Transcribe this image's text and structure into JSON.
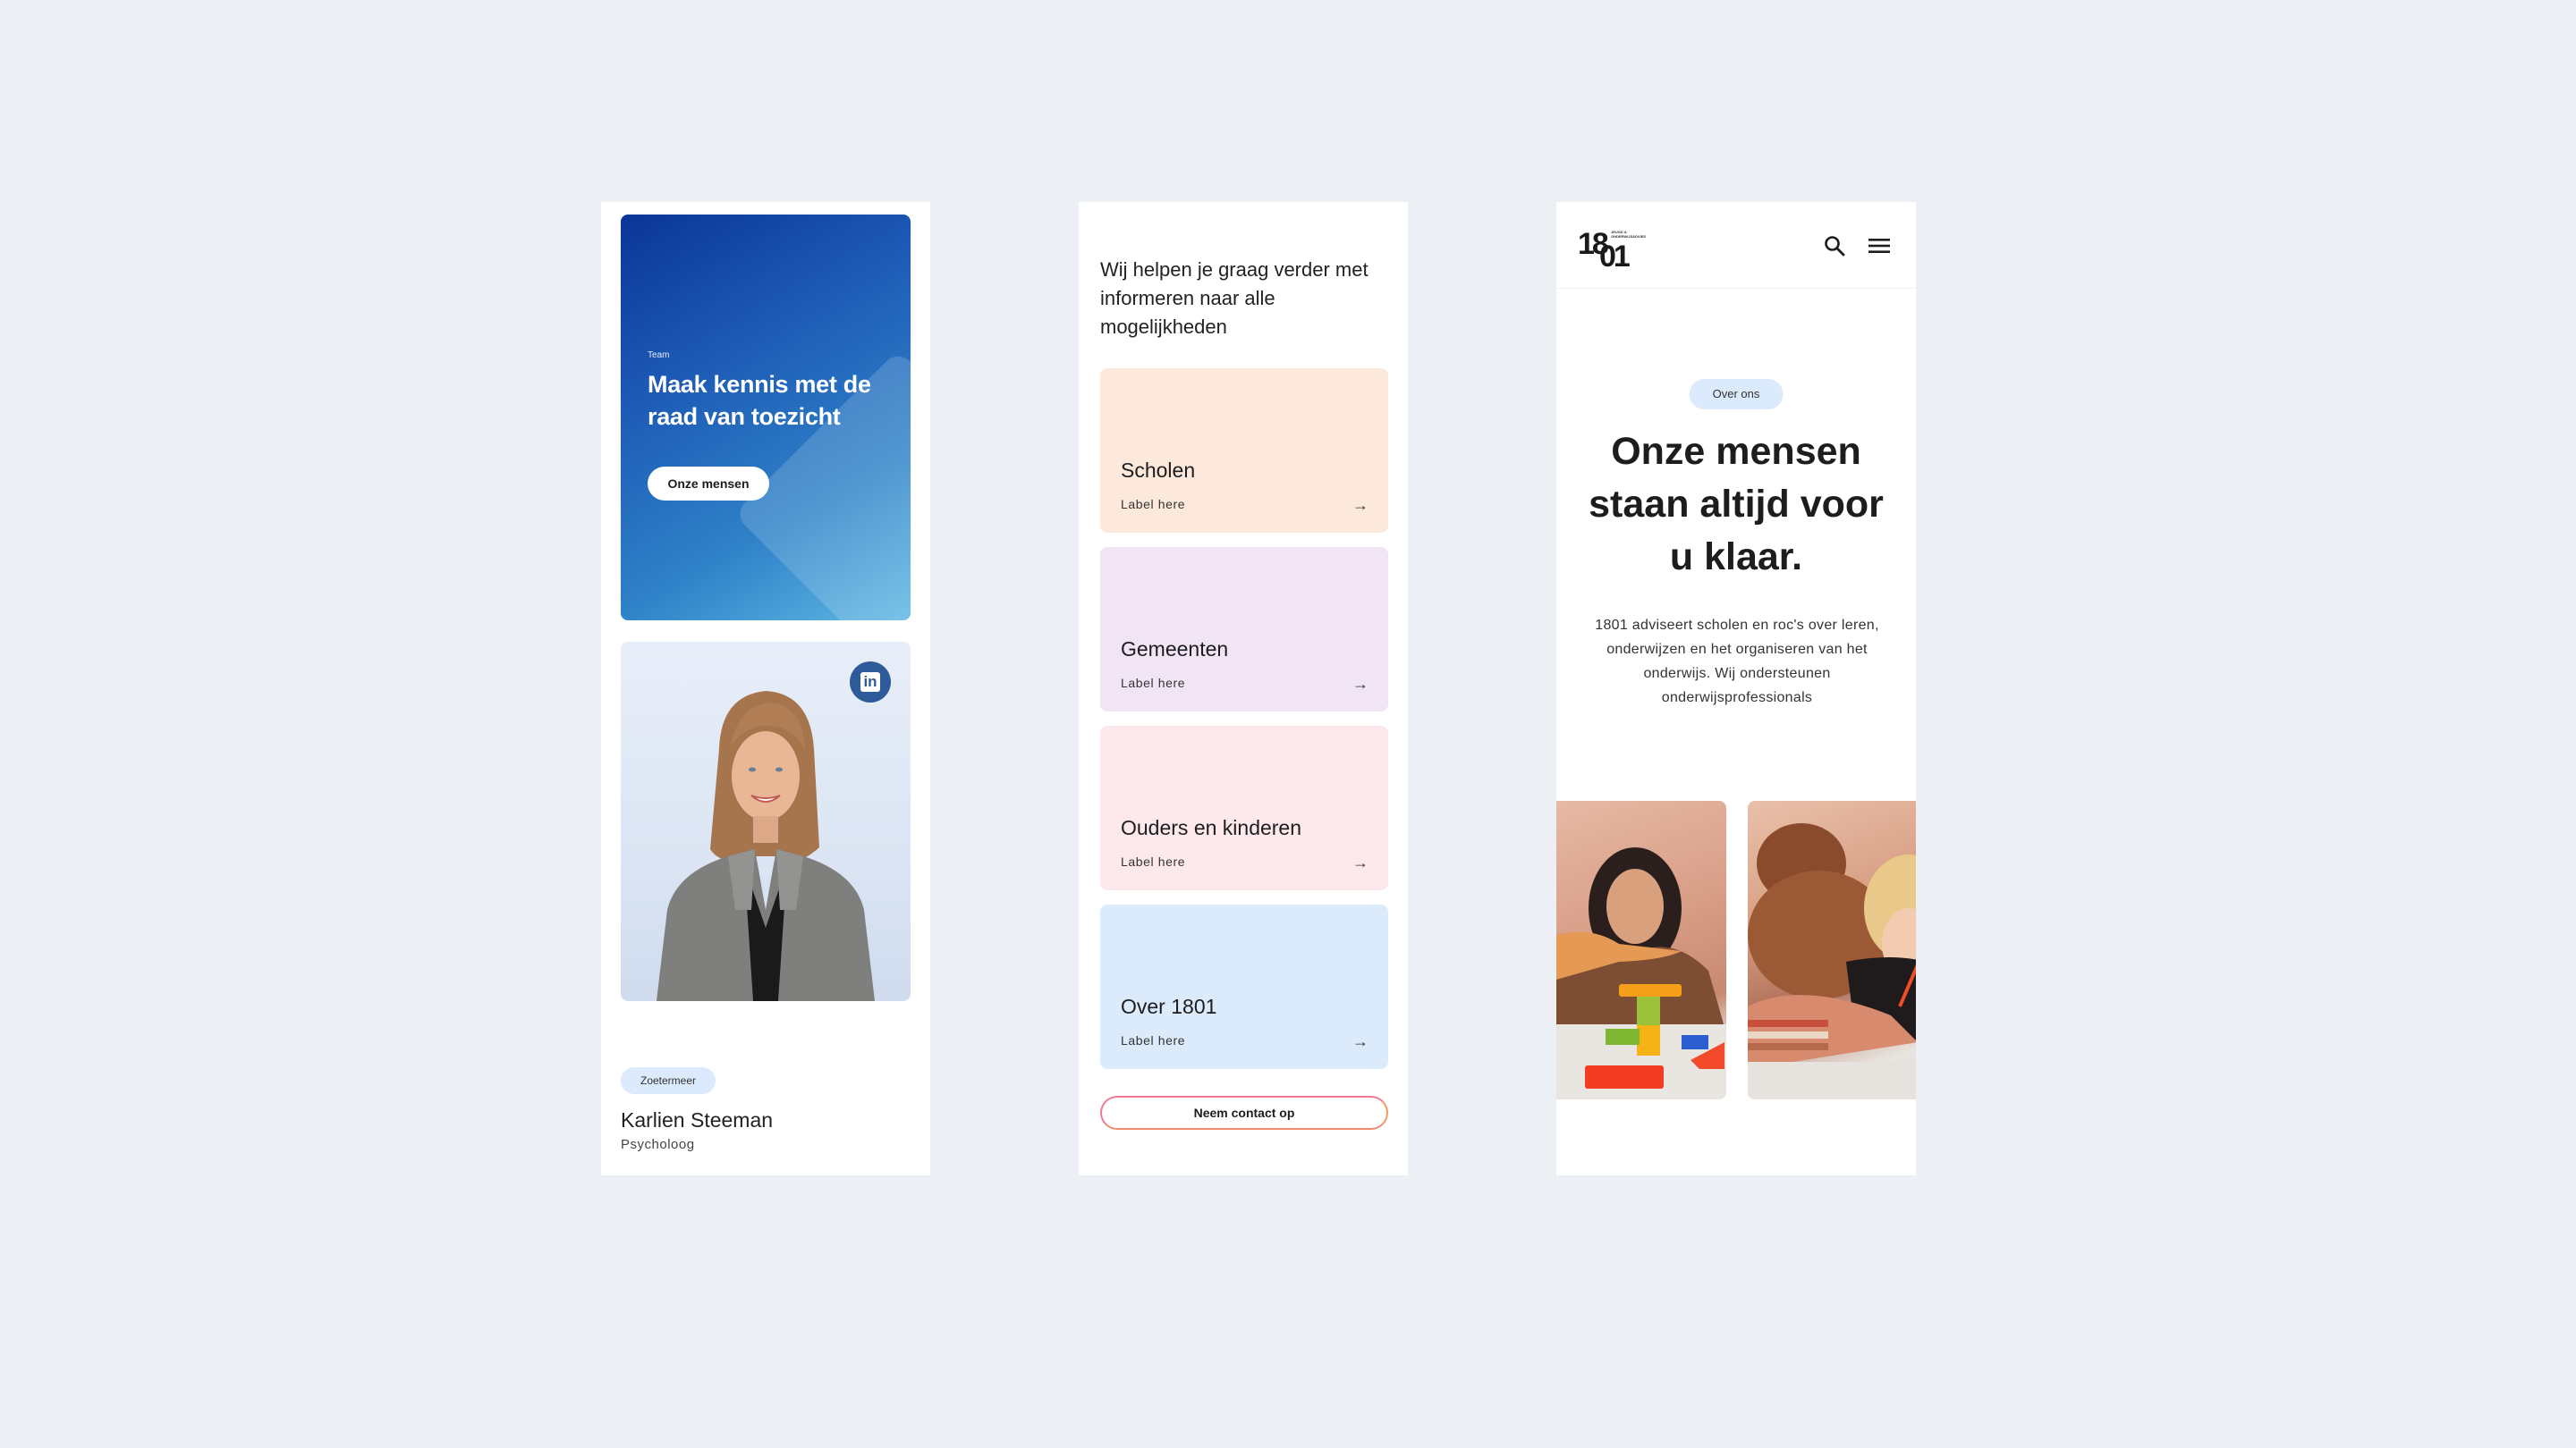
{
  "colors": {
    "page_background": "#ecf0f4",
    "team_card_gradient_start": "#0a3598",
    "team_card_gradient_end": "#5fb8e4",
    "linkedin_blue": "#2d5a98",
    "badge_blue": "#dbeafc",
    "tile_scholen": "#fde8dc",
    "tile_gemeenten": "#f0e4f5",
    "tile_ouders": "#fde9ec",
    "tile_over": "#dcebfb",
    "contact_border_start": "#f07a93",
    "contact_border_end": "#f29a5e"
  },
  "team_panel": {
    "card": {
      "eyebrow": "Team",
      "headline": "Maak kennis met de raad van toezicht",
      "button_label": "Onze mensen"
    },
    "profile": {
      "photo_alt": "Portrait of Karlien Steeman",
      "social_icon": "linkedin-icon",
      "social_label": "in",
      "location": "Zoetermeer",
      "name": "Karlien Steeman",
      "role": "Psycholoog"
    }
  },
  "help_panel": {
    "intro": "Wij helpen je graag verder met informeren naar alle mogelijkheden",
    "tiles": [
      {
        "title": "Scholen",
        "label": "Label here",
        "arrow": "→",
        "color": "#fde8dc"
      },
      {
        "title": "Gemeenten",
        "label": "Label here",
        "arrow": "→",
        "color": "#f0e4f5"
      },
      {
        "title": "Ouders en kinderen",
        "label": "Label here",
        "arrow": "→",
        "color": "#fde9ec"
      },
      {
        "title": "Over 1801",
        "label": "Label here",
        "arrow": "→",
        "color": "#dcebfb"
      }
    ],
    "contact_button": "Neem contact op"
  },
  "about_panel": {
    "header": {
      "logo_part_1": "18",
      "logo_part_2": "01",
      "logo_tagline": "JEUGD & ONDERWIJSADVIES",
      "search_icon": "search-icon",
      "menu_icon": "hamburger-menu-icon"
    },
    "badge": "Over ons",
    "title": "Onze mensen staan altijd voor u klaar.",
    "description": "1801 adviseert scholen en roc's over leren, onderwijzen en het organiseren van het onderwijs. Wij ondersteunen onderwijsprofessionals",
    "photos": [
      {
        "alt": "Woman building a block tower with a child"
      },
      {
        "alt": "Children drawing at a table"
      }
    ]
  }
}
